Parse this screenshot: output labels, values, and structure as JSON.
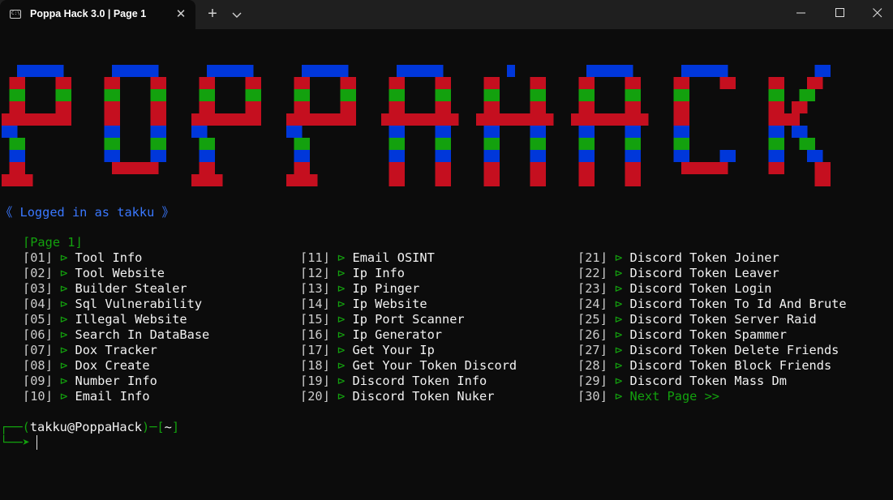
{
  "window": {
    "tab_title": "Poppa Hack 3.0 | Page 1",
    "tab_icon": "terminal-icon",
    "close_tab_label": "✕",
    "new_tab_label": "+"
  },
  "banner_text": "POPPAHACK",
  "banner_colors": [
    "#0037da",
    "#c50f1f",
    "#13a10e"
  ],
  "login_status": "《 Logged in as takku 》",
  "page_label": "⌈Page 1⌋",
  "menu": {
    "columns": [
      [
        {
          "num": "⌈01⌋",
          "arrow": "⊳",
          "label": "Tool Info"
        },
        {
          "num": "⌈02⌋",
          "arrow": "⊳",
          "label": "Tool Website"
        },
        {
          "num": "⌈03⌋",
          "arrow": "⊳",
          "label": "Builder Stealer"
        },
        {
          "num": "⌈04⌋",
          "arrow": "⊳",
          "label": "Sql Vulnerability"
        },
        {
          "num": "⌈05⌋",
          "arrow": "⊳",
          "label": "Illegal Website"
        },
        {
          "num": "⌈06⌋",
          "arrow": "⊳",
          "label": "Search In DataBase"
        },
        {
          "num": "⌈07⌋",
          "arrow": "⊳",
          "label": "Dox Tracker"
        },
        {
          "num": "⌈08⌋",
          "arrow": "⊳",
          "label": "Dox Create"
        },
        {
          "num": "⌈09⌋",
          "arrow": "⊳",
          "label": "Number Info"
        },
        {
          "num": "⌈10⌋",
          "arrow": "⊳",
          "label": "Email Info"
        }
      ],
      [
        {
          "num": "⌈11⌋",
          "arrow": "⊳",
          "label": "Email OSINT"
        },
        {
          "num": "⌈12⌋",
          "arrow": "⊳",
          "label": "Ip Info"
        },
        {
          "num": "⌈13⌋",
          "arrow": "⊳",
          "label": "Ip Pinger"
        },
        {
          "num": "⌈14⌋",
          "arrow": "⊳",
          "label": "Ip Website"
        },
        {
          "num": "⌈15⌋",
          "arrow": "⊳",
          "label": "Ip Port Scanner"
        },
        {
          "num": "⌈16⌋",
          "arrow": "⊳",
          "label": "Ip Generator"
        },
        {
          "num": "⌈17⌋",
          "arrow": "⊳",
          "label": "Get Your Ip"
        },
        {
          "num": "⌈18⌋",
          "arrow": "⊳",
          "label": "Get Your Token Discord"
        },
        {
          "num": "⌈19⌋",
          "arrow": "⊳",
          "label": "Discord Token Info"
        },
        {
          "num": "⌈20⌋",
          "arrow": "⊳",
          "label": "Discord Token Nuker"
        }
      ],
      [
        {
          "num": "⌈21⌋",
          "arrow": "⊳",
          "label": "Discord Token Joiner"
        },
        {
          "num": "⌈22⌋",
          "arrow": "⊳",
          "label": "Discord Token Leaver"
        },
        {
          "num": "⌈23⌋",
          "arrow": "⊳",
          "label": "Discord Token Login"
        },
        {
          "num": "⌈24⌋",
          "arrow": "⊳",
          "label": "Discord Token To Id And Brute"
        },
        {
          "num": "⌈25⌋",
          "arrow": "⊳",
          "label": "Discord Token Server Raid"
        },
        {
          "num": "⌈26⌋",
          "arrow": "⊳",
          "label": "Discord Token Spammer"
        },
        {
          "num": "⌈27⌋",
          "arrow": "⊳",
          "label": "Discord Token Delete Friends"
        },
        {
          "num": "⌈28⌋",
          "arrow": "⊳",
          "label": "Discord Token Block Friends"
        },
        {
          "num": "⌈29⌋",
          "arrow": "⊳",
          "label": "Discord Token Mass Dm"
        },
        {
          "num": "⌈30⌋",
          "arrow": "⊳",
          "label": "Next Page >>",
          "highlight": true
        }
      ]
    ]
  },
  "prompt": {
    "line1_prefix": "┌──(",
    "user_host": "takku@PoppaHack",
    "line1_mid": ")─[",
    "path": "~",
    "line1_suffix": "]",
    "line2": "└──➤"
  }
}
